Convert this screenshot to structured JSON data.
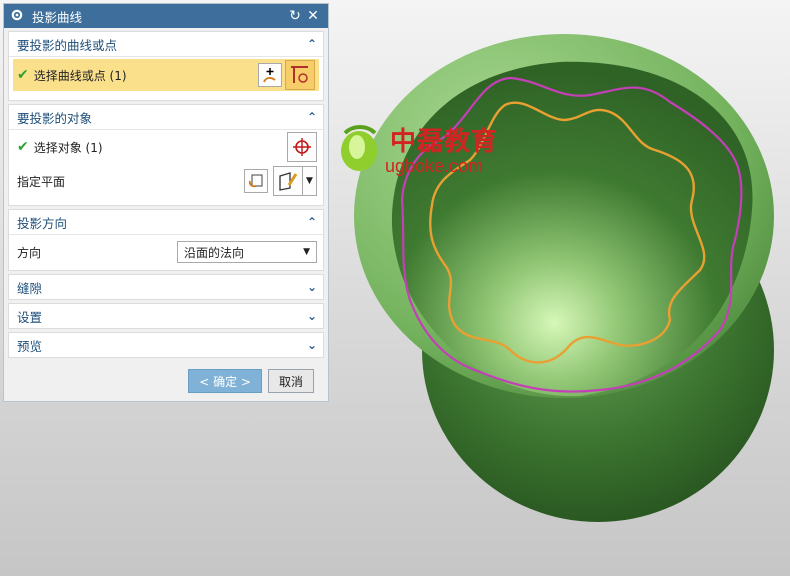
{
  "dialog": {
    "title": "投影曲线",
    "sections": {
      "curves": {
        "label": "要投影的曲线或点",
        "select_label": "选择曲线或点 (1)"
      },
      "target": {
        "label": "要投影的对象",
        "select_label": "选择对象 (1)",
        "plane_label": "指定平面"
      },
      "direction": {
        "label": "投影方向",
        "dir_label": "方向",
        "dir_value": "沿面的法向"
      },
      "gap": {
        "label": "缝隙"
      },
      "settings": {
        "label": "设置"
      },
      "preview": {
        "label": "预览"
      }
    },
    "buttons": {
      "ok": "< 确定 >",
      "cancel": "取消"
    }
  },
  "watermark": {
    "title": "中磊教育",
    "url": "ugboke.com"
  },
  "colors": {
    "title_bar": "#3e6f9c",
    "selection_highlight": "#fbe08c",
    "model_green": "#4c8a3c",
    "curve_magenta": "#c43fb8",
    "curve_orange": "#e8a033"
  }
}
